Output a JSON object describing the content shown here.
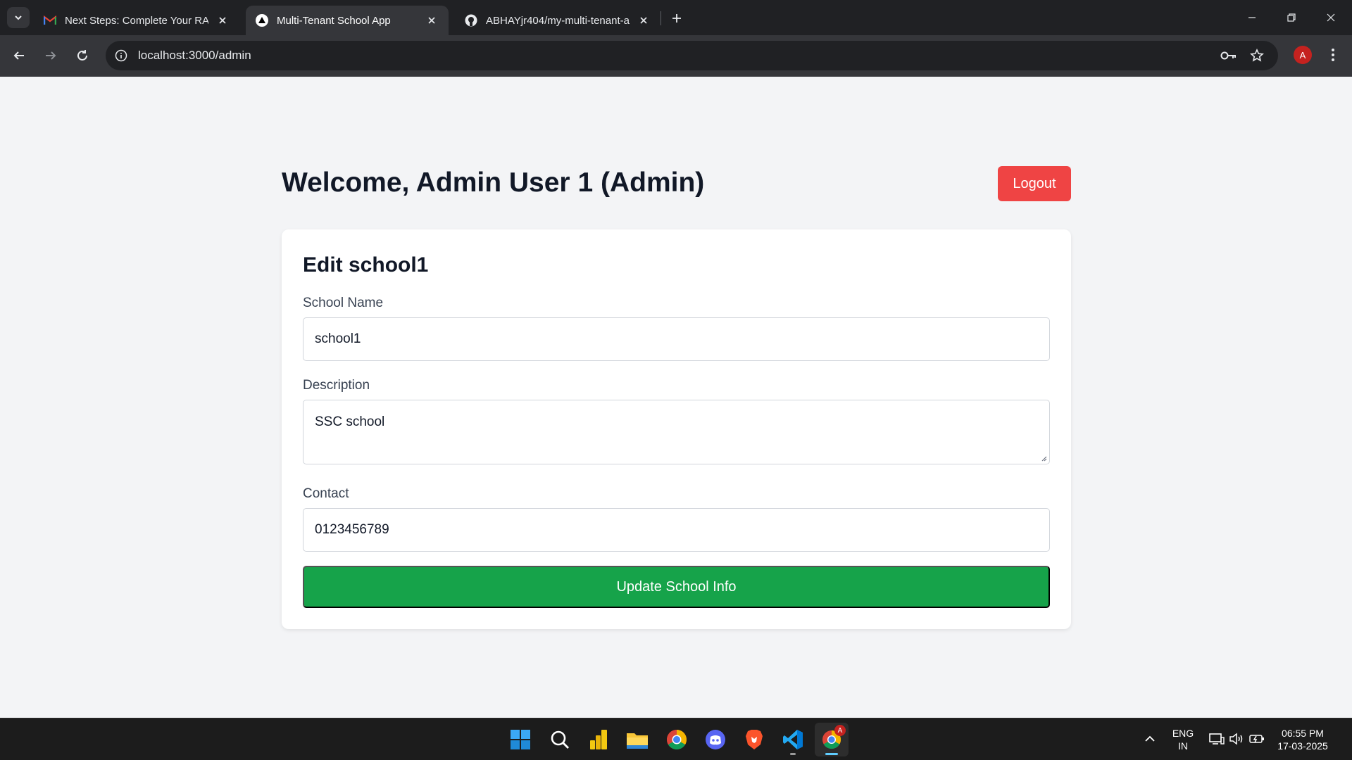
{
  "browser": {
    "tabs": [
      {
        "title": "Next Steps: Complete Your RAR",
        "icon": "gmail-icon",
        "active": false
      },
      {
        "title": "Multi-Tenant School App",
        "icon": "vercel-icon",
        "active": true
      },
      {
        "title": "ABHAYjr404/my-multi-tenant-a",
        "icon": "github-icon",
        "active": false
      }
    ],
    "url": "localhost:3000/admin",
    "profile_initial": "A"
  },
  "page": {
    "welcome": "Welcome, Admin User 1 (Admin)",
    "logout_label": "Logout"
  },
  "form": {
    "title": "Edit school1",
    "name_label": "School Name",
    "name_value": "school1",
    "description_label": "Description",
    "description_value": "SSC school",
    "contact_label": "Contact",
    "contact_value": "0123456789",
    "submit_label": "Update School Info"
  },
  "taskbar": {
    "apps": [
      "start-icon",
      "search-icon",
      "power-bi-icon",
      "file-explorer-icon",
      "chrome-icon",
      "discord-icon",
      "brave-icon",
      "vscode-icon",
      "chrome-profile-icon"
    ],
    "language_line1": "ENG",
    "language_line2": "IN",
    "time": "06:55 PM",
    "date": "17-03-2025",
    "chrome_badge": "A"
  },
  "colors": {
    "logout": "#ef4444",
    "submit": "#16a34a",
    "page_bg": "#f3f4f6"
  }
}
